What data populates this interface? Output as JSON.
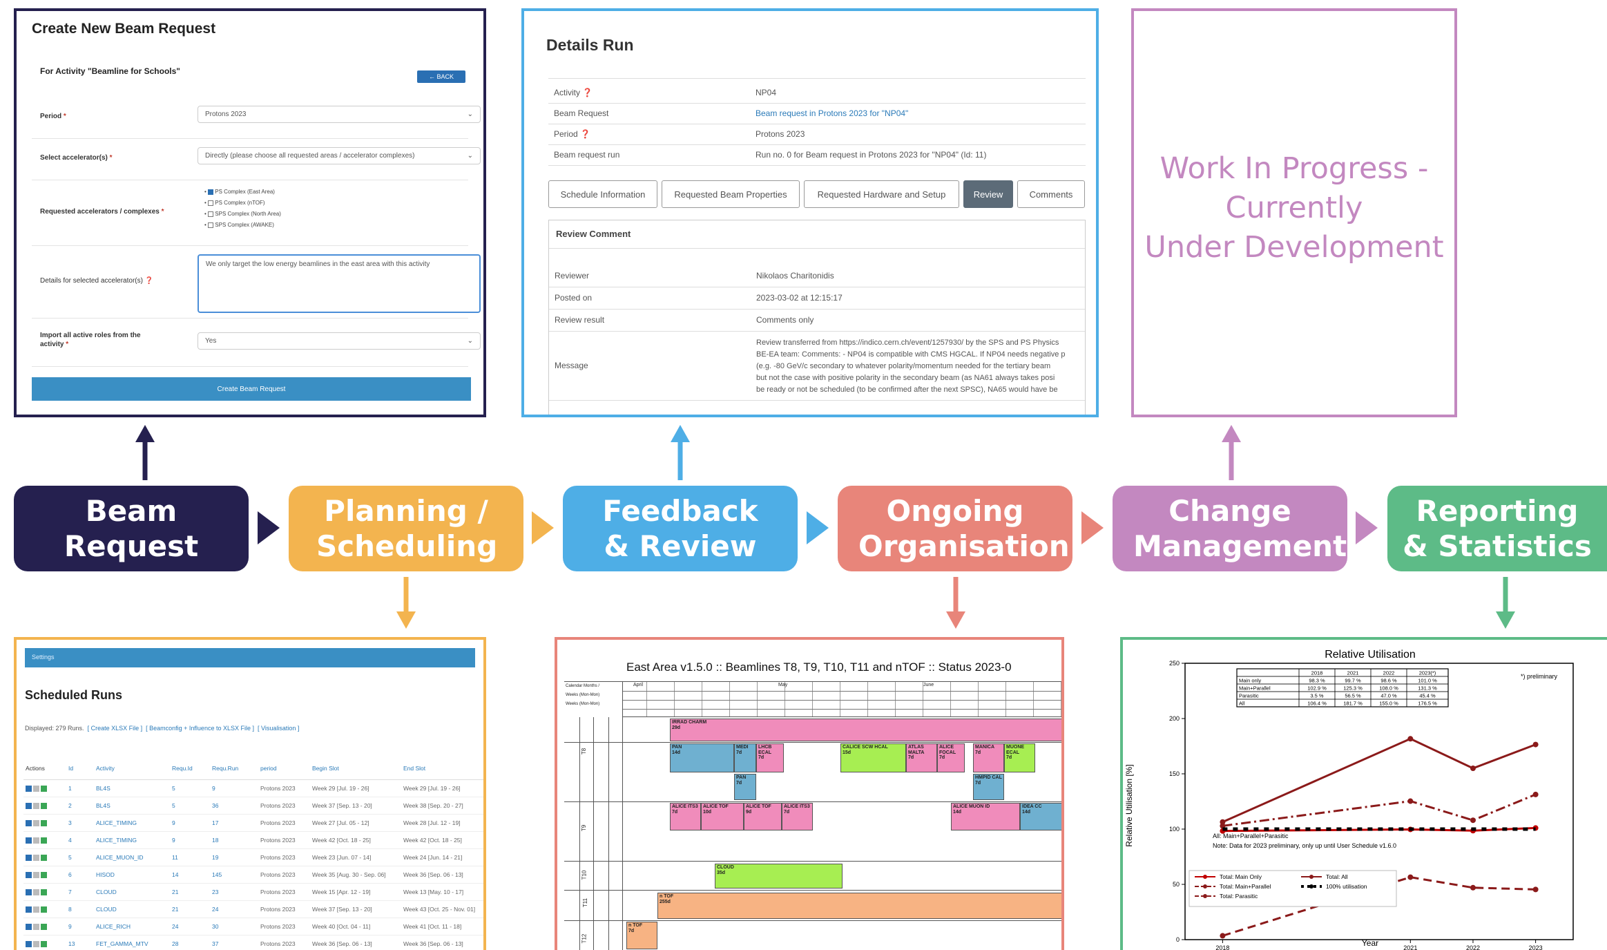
{
  "colors": {
    "beam_request": "#25204f",
    "planning": "#f3b44f",
    "feedback": "#4eaee6",
    "ongoing": "#e8857a",
    "change": "#c388c0",
    "reporting": "#5dbb87"
  },
  "stages": [
    {
      "label": "Beam Request"
    },
    {
      "label": "Planning / Scheduling"
    },
    {
      "label": "Feedback & Review"
    },
    {
      "label": "Ongoing Organisation"
    },
    {
      "label": "Change Management"
    },
    {
      "label": "Reporting & Statistics"
    }
  ],
  "beam_request_form": {
    "title": "Create New Beam Request",
    "subtitle": "For Activity \"Beamline for Schools\"",
    "back_label": "← BACK",
    "period_label": "Period",
    "period_value": "Protons 2023",
    "accel_label": "Select accelerator(s)",
    "accel_value": "Directly (please choose all requested areas / accelerator complexes)",
    "complex_label": "Requested accelerators / complexes",
    "complexes": [
      {
        "label": "PS Complex (East Area)",
        "checked": true
      },
      {
        "label": "PS Complex (nTOF)",
        "checked": false
      },
      {
        "label": "SPS Complex (North Area)",
        "checked": false
      },
      {
        "label": "SPS Complex (AWAKE)",
        "checked": false
      }
    ],
    "details_label": "Details for selected accelerator(s)",
    "details_value": "We only target the low energy beamlines in the east area with this activity",
    "import_label": "Import all active roles from the activity",
    "import_value": "Yes",
    "submit_label": "Create Beam Request"
  },
  "details_run": {
    "title": "Details Run",
    "rows": [
      {
        "key": "Activity",
        "value": "NP04"
      },
      {
        "key": "Beam Request",
        "value": "Beam request in Protons 2023 for \"NP04\""
      },
      {
        "key": "Period",
        "value": "Protons 2023"
      },
      {
        "key": "Beam request run",
        "value": "Run no. 0 for Beam request in Protons 2023 for \"NP04\" (Id: 11)"
      }
    ],
    "tabs": [
      "Schedule Information",
      "Requested Beam Properties",
      "Requested Hardware and Setup",
      "Review",
      "Comments"
    ],
    "active_tab": "Review",
    "review_title": "Review Comment",
    "review_rows": [
      {
        "key": "Reviewer",
        "value": "Nikolaos Charitonidis"
      },
      {
        "key": "Posted on",
        "value": "2023-03-02 at 12:15:17"
      },
      {
        "key": "Review result",
        "value": "Comments only"
      }
    ],
    "message_label": "Message",
    "message_lines": [
      "Review transferred from https://indico.cern.ch/event/1257930/ by the SPS and PS Physics",
      "BE-EA team: Comments: - NP04 is compatible with CMS HGCAL. If NP04 needs negative p",
      "(e.g. -80 GeV/c secondary to whatever polarity/momentum needed for the tertiary beam",
      "but not the case with positive polarity in the secondary beam (as NA61 always takes posi",
      "be ready or not be scheduled (to be confirmed after the next SPSC), NA65 would have be"
    ]
  },
  "wip": {
    "lines": [
      "Work In Progress  -",
      "Currently",
      "Under Development"
    ]
  },
  "scheduled_runs": {
    "header_bar": "Settings",
    "title": "Scheduled Runs",
    "displayed": "Displayed: 279 Runs.",
    "links": [
      "[ Create XLSX File ]",
      "[ Beamconfig + Influence to XLSX File ]",
      "[ Visualisation ]"
    ],
    "columns": [
      "Actions",
      "Id",
      "Activity",
      "Requ.Id",
      "Requ.Run",
      "period",
      "Begin Slot",
      "End Slot"
    ],
    "rows": [
      [
        "1",
        "BL4S",
        "5",
        "9",
        "Protons 2023",
        "Week 29 [Jul. 19 - 26]",
        "Week 29 [Jul. 19 - 26]"
      ],
      [
        "2",
        "BL4S",
        "5",
        "36",
        "Protons 2023",
        "Week 37 [Sep. 13 - 20]",
        "Week 38 [Sep. 20 - 27]"
      ],
      [
        "3",
        "ALICE_TIMING",
        "9",
        "17",
        "Protons 2023",
        "Week 27 [Jul. 05 - 12]",
        "Week 28 [Jul. 12 - 19]"
      ],
      [
        "4",
        "ALICE_TIMING",
        "9",
        "18",
        "Protons 2023",
        "Week 42 [Oct. 18 - 25]",
        "Week 42 [Oct. 18 - 25]"
      ],
      [
        "5",
        "ALICE_MUON_ID",
        "11",
        "19",
        "Protons 2023",
        "Week 23 [Jun. 07 - 14]",
        "Week 24 [Jun. 14 - 21]"
      ],
      [
        "6",
        "HISOD",
        "14",
        "145",
        "Protons 2023",
        "Week 35 [Aug. 30 - Sep. 06]",
        "Week 36 [Sep. 06 - 13]"
      ],
      [
        "7",
        "CLOUD",
        "21",
        "23",
        "Protons 2023",
        "Week 15 [Apr. 12 - 19]",
        "Week 13 [May. 10 - 17]"
      ],
      [
        "8",
        "CLOUD",
        "21",
        "24",
        "Protons 2023",
        "Week 37 [Sep. 13 - 20]",
        "Week 43 [Oct. 25 - Nov. 01]"
      ],
      [
        "9",
        "ALICE_RICH",
        "24",
        "30",
        "Protons 2023",
        "Week 40 [Oct. 04 - 11]",
        "Week 41 [Oct. 11 - 18]"
      ],
      [
        "13",
        "FET_GAMMA_MTV",
        "28",
        "37",
        "Protons 2023",
        "Week 36 [Sep. 06 - 13]",
        "Week 36 [Sep. 06 - 13]"
      ]
    ]
  },
  "east_area": {
    "title": "East Area v1.5.0 :: Beamlines T8, T9, T10, T11 and nTOF :: Status 2023-0",
    "months": [
      "April",
      "May",
      "June"
    ],
    "beamlines": [
      "T8",
      "T9",
      "T10",
      "T11",
      "T12"
    ],
    "bars": [
      {
        "label": "IRRAD CHARM",
        "sub": "29d"
      },
      {
        "label": "PAN",
        "sub": "14d"
      },
      {
        "label": "MEDI",
        "sub": "7d"
      },
      {
        "label": "LHCB ECAL",
        "sub": "7d"
      },
      {
        "label": "CALICE SCW HCAL",
        "sub": "15d"
      },
      {
        "label": "ATLAS MALTA",
        "sub": "7d"
      },
      {
        "label": "ALICE FOCAL",
        "sub": "7d"
      },
      {
        "label": "MANICA",
        "sub": "7d"
      },
      {
        "label": "MUONE ECAL",
        "sub": "7d"
      },
      {
        "label": "PAN",
        "sub": "7d"
      },
      {
        "label": "HMPID CAL",
        "sub": "7d"
      },
      {
        "label": "ALICE ITS3",
        "sub": "7d"
      },
      {
        "label": "ALICE TOF",
        "sub": "10d"
      },
      {
        "label": "ALICE TOF",
        "sub": "9d"
      },
      {
        "label": "ALICE ITS3",
        "sub": "7d"
      },
      {
        "label": "ALICE MUON ID",
        "sub": "14d"
      },
      {
        "label": "IDEA CC",
        "sub": "14d"
      },
      {
        "label": "CLOUD",
        "sub": "35d"
      },
      {
        "label": "n TOF",
        "sub": "255d"
      },
      {
        "label": "n TOF",
        "sub": "7d"
      }
    ]
  },
  "chart_data": {
    "type": "line",
    "title": "Relative Utilisation",
    "xlabel": "Year",
    "ylabel": "Relative Utilisation [%]",
    "x": [
      2018,
      2021,
      2022,
      2023
    ],
    "ylim": [
      0,
      250
    ],
    "yticks": [
      0,
      50,
      100,
      150,
      200,
      250
    ],
    "series": [
      {
        "name": "Total: Main Only",
        "values": [
          98.3,
          99.7,
          98.6,
          101.0
        ],
        "color": "#c00000",
        "style": "solid"
      },
      {
        "name": "Total: All",
        "values": [
          106.4,
          181.7,
          155.0,
          176.5
        ],
        "color": "#8b1a1a",
        "style": "solid-marker"
      },
      {
        "name": "Total: Main+Parallel",
        "values": [
          102.9,
          125.3,
          108.0,
          131.3
        ],
        "color": "#8b1a1a",
        "style": "dashdot"
      },
      {
        "name": "Total: Parasitic",
        "values": [
          3.5,
          56.5,
          47.0,
          45.4
        ],
        "color": "#8b1a1a",
        "style": "dashed"
      },
      {
        "name": "100% utilisation",
        "values": [
          100,
          100,
          100,
          100
        ],
        "color": "#000000",
        "style": "dotted"
      }
    ],
    "table": {
      "columns": [
        "",
        "2018",
        "2021",
        "2022",
        "2023(*)"
      ],
      "rows": [
        [
          "Main only",
          "98.3 %",
          "99.7 %",
          "98.6 %",
          "101.0 %"
        ],
        [
          "Main+Parallel",
          "102.9 %",
          "125.3 %",
          "108.0 %",
          "131.3 %"
        ],
        [
          "Parasitic",
          "3.5 %",
          "56.5 %",
          "47.0 %",
          "45.4 %"
        ],
        [
          "All",
          "106.4 %",
          "181.7 %",
          "155.0 %",
          "176.5 %"
        ]
      ]
    },
    "preliminary_note": "*) preliminary",
    "notes": [
      "All: Main+Parallel+Parasitic",
      "Note: Data for 2023 preliminary, only up until User Schedule v1.6.0"
    ],
    "legend": "bottom-left",
    "grid": false
  }
}
